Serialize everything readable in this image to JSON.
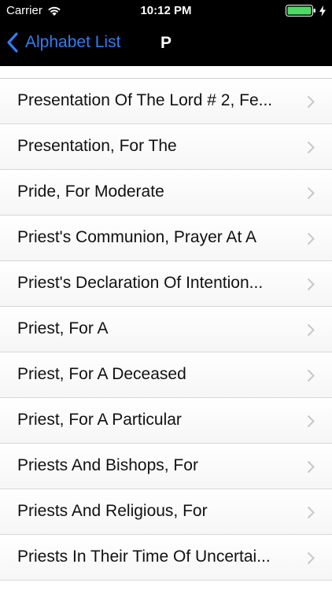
{
  "status": {
    "carrier": "Carrier",
    "time": "10:12 PM",
    "wifi_icon": "wifi-icon",
    "battery_icon": "battery-icon",
    "charging_icon": "charging-bolt-icon"
  },
  "nav": {
    "back_label": "Alphabet List",
    "title": "P",
    "accent_color": "#2f7df6"
  },
  "list": {
    "items": [
      {
        "label": "Presentation Of The Lord # 2, Fe..."
      },
      {
        "label": "Presentation, For The"
      },
      {
        "label": "Pride, For Moderate"
      },
      {
        "label": "Priest's Communion, Prayer At A"
      },
      {
        "label": "Priest's Declaration Of Intention..."
      },
      {
        "label": "Priest, For A"
      },
      {
        "label": "Priest, For A Deceased"
      },
      {
        "label": "Priest, For A Particular"
      },
      {
        "label": "Priests And Bishops, For"
      },
      {
        "label": "Priests And Religious, For"
      },
      {
        "label": "Priests In Their Time Of Uncertai..."
      }
    ]
  }
}
